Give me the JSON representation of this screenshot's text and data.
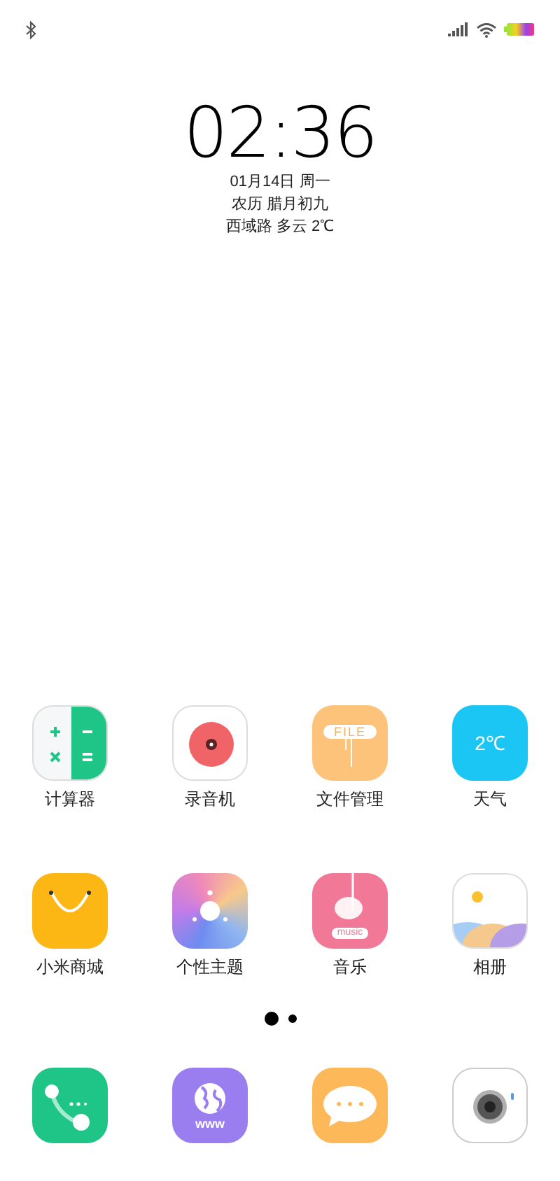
{
  "clock": {
    "time": "02:36",
    "date": "01月14日 周一",
    "lunar": "农历 腊月初九",
    "weather": "西域路 多云 2℃"
  },
  "apps": [
    {
      "kind": "calculator",
      "label": "计算器"
    },
    {
      "kind": "recorder",
      "label": "录音机"
    },
    {
      "kind": "files",
      "label": "文件管理",
      "icon_text": "FILE"
    },
    {
      "kind": "weather",
      "label": "天气",
      "icon_text": "2℃"
    },
    {
      "kind": "store",
      "label": "小米商城"
    },
    {
      "kind": "themes",
      "label": "个性主题"
    },
    {
      "kind": "music",
      "label": "音乐",
      "icon_text": "music"
    },
    {
      "kind": "gallery",
      "label": "相册"
    }
  ],
  "page_dots": [
    {
      "selected": true
    },
    {
      "selected": false
    }
  ],
  "dock": [
    {
      "kind": "phone"
    },
    {
      "kind": "browser",
      "icon_text": "www"
    },
    {
      "kind": "messages"
    },
    {
      "kind": "camera"
    }
  ]
}
